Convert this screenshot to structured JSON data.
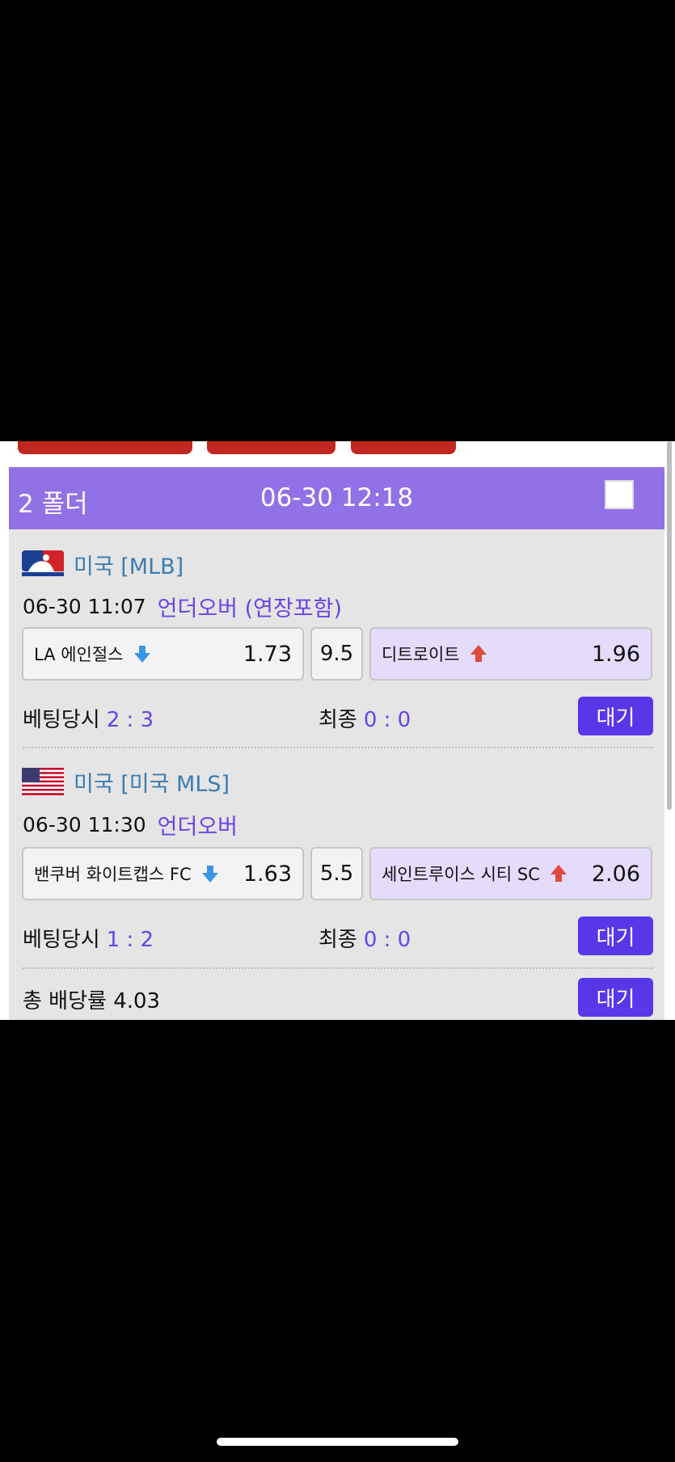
{
  "header": {
    "folder_label": "2 폴더",
    "datetime": "06-30 12:18",
    "checkbox_checked": false
  },
  "matches": [
    {
      "flag_icon": "mlb-logo-icon",
      "league": "미국 [MLB]",
      "time": "06-30 11:07",
      "market": "언더오버 (연장포함)",
      "home_team": "LA 에인절스",
      "home_arrow": "arrow-down-icon",
      "home_odds": "1.73",
      "line": "9.5",
      "away_team": "디트로이트",
      "away_arrow": "arrow-up-icon",
      "away_odds": "1.96",
      "bet_time_label": "베팅당시",
      "bet_time_score": "2 : 3",
      "final_label": "최종",
      "final_score": "0 : 0",
      "status": "대기"
    },
    {
      "flag_icon": "usa-flag-icon",
      "league": "미국 [미국 MLS]",
      "time": "06-30 11:30",
      "market": "언더오버",
      "home_team": "밴쿠버 화이트캡스 FC",
      "home_arrow": "arrow-down-icon",
      "home_odds": "1.63",
      "line": "5.5",
      "away_team": "세인트루이스 시티 SC",
      "away_arrow": "arrow-up-icon",
      "away_odds": "2.06",
      "bet_time_label": "베팅당시",
      "bet_time_score": "1 : 2",
      "final_label": "최종",
      "final_score": "0 : 0",
      "status": "대기"
    }
  ],
  "summary": {
    "total_odds_label": "총 배당률 4.03",
    "status": "대기"
  },
  "colors": {
    "header_purple": "#9270e6",
    "button_purple": "#5737e8",
    "accent_text": "#6a43e8",
    "league_blue": "#3d7cb0",
    "tab_red": "#c0271e",
    "arrow_blue": "#3a97e6",
    "arrow_red": "#e0493c"
  }
}
